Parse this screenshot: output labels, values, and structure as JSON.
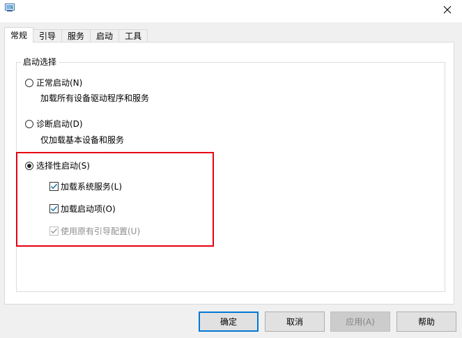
{
  "window": {
    "close_glyph": "✕"
  },
  "tabs": [
    {
      "label": "常规",
      "active": true
    },
    {
      "label": "引导",
      "active": false
    },
    {
      "label": "服务",
      "active": false
    },
    {
      "label": "启动",
      "active": false
    },
    {
      "label": "工具",
      "active": false
    }
  ],
  "startup_selection": {
    "title": "启动选择",
    "normal": {
      "label": "正常启动(N)",
      "description": "加载所有设备驱动程序和服务",
      "selected": false
    },
    "diagnostic": {
      "label": "诊断启动(D)",
      "description": "仅加载基本设备和服务",
      "selected": false
    },
    "selective": {
      "label": "选择性启动(S)",
      "selected": true,
      "options": [
        {
          "label": "加载系统服务(L)",
          "checked": true,
          "enabled": true
        },
        {
          "label": "加载启动项(O)",
          "checked": true,
          "enabled": true
        },
        {
          "label": "使用原有引导配置(U)",
          "checked": true,
          "enabled": false
        }
      ]
    }
  },
  "buttons": {
    "ok": "确定",
    "cancel": "取消",
    "apply": "应用(A)",
    "help": "帮助"
  },
  "colors": {
    "highlight": "#e60012",
    "checkmark": "#1a6ea8",
    "default_button_border": "#0078d7"
  }
}
